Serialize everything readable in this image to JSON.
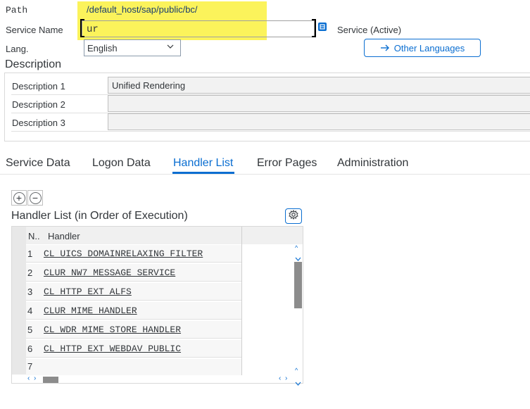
{
  "fields": {
    "path_label": "Path",
    "path_value": "/default_host/sap/public/bc/",
    "service_name_label": "Service Name",
    "service_name_value": "ur",
    "service_status": "Service (Active)",
    "lang_label": "Lang.",
    "lang_value": "English",
    "other_languages_label": "Other Languages"
  },
  "description": {
    "title": "Description",
    "rows": [
      {
        "label": "Description 1",
        "value": "Unified Rendering"
      },
      {
        "label": "Description 2",
        "value": ""
      },
      {
        "label": "Description 3",
        "value": ""
      }
    ]
  },
  "tabs": [
    {
      "label": "Service Data",
      "active": false
    },
    {
      "label": "Logon Data",
      "active": false
    },
    {
      "label": "Handler List",
      "active": true
    },
    {
      "label": "Error Pages",
      "active": false
    },
    {
      "label": "Administration",
      "active": false
    }
  ],
  "handler_list": {
    "title": "Handler List (in Order of Execution)",
    "columns": [
      "N..",
      "Handler"
    ],
    "rows": [
      {
        "n": "1",
        "handler": "CL_UICS_DOMAINRELAXING_FILTER"
      },
      {
        "n": "2",
        "handler": "CLUR_NW7_MESSAGE_SERVICE"
      },
      {
        "n": "3",
        "handler": "CL_HTTP_EXT_ALFS"
      },
      {
        "n": "4",
        "handler": "CLUR_MIME_HANDLER"
      },
      {
        "n": "5",
        "handler": "CL_WDR_MIME_STORE_HANDLER"
      },
      {
        "n": "6",
        "handler": "CL_HTTP_EXT_WEBDAV_PUBLIC"
      },
      {
        "n": "7",
        "handler": ""
      }
    ]
  },
  "icons": {
    "value_help": "value-help-icon",
    "add": "plus-circle-icon",
    "remove": "minus-circle-icon",
    "settings": "gear-icon",
    "arrow": "arrow-right-icon"
  },
  "colors": {
    "accent": "#0a6ed1",
    "highlight": "#fbf35b"
  }
}
